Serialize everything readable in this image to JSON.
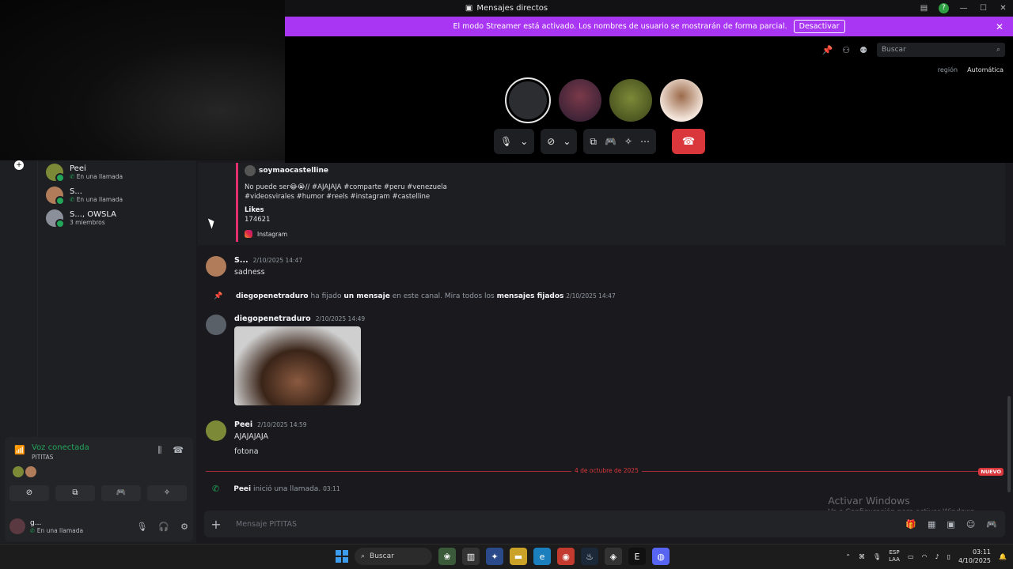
{
  "window": {
    "title": "Mensajes directos"
  },
  "banner": {
    "text": "El modo Streamer está activado. Los nombres de usuario se mostrarán de forma parcial.",
    "button": "Desactivar",
    "close": "✕"
  },
  "call": {
    "search_placeholder": "Buscar",
    "region_label": "región",
    "region_value": "Automática"
  },
  "sidebar": {
    "dms": [
      {
        "name": "Peei",
        "sub": "En una llamada"
      },
      {
        "name": "S...",
        "sub": "En una llamada"
      },
      {
        "name": "S..., OWSLA",
        "sub": "3 miembros"
      }
    ],
    "voice": {
      "status": "Voz conectada",
      "channel": "PITITAS"
    },
    "user": {
      "name": "g...",
      "status": "En una llamada"
    }
  },
  "chat": {
    "embed": {
      "author": "soymaocastelline",
      "text": "No puede ser😂😭// #AJAJAJA #comparte #peru #venezuela #videosvirales #humor #reels #instagram #castelline",
      "likes_label": "Likes",
      "likes_value": "174621",
      "source": "Instagram"
    },
    "messages": [
      {
        "author": "S...",
        "time": "2/10/2025 14:47",
        "text": "sadness"
      },
      {
        "author": "diegopenetraduro",
        "time": "2/10/2025 14:49"
      },
      {
        "author": "Peei",
        "time": "2/10/2025 14:59",
        "text": "AJAJAJAJA",
        "text2": "fotona"
      }
    ],
    "pin_event": {
      "user": "diegopenetraduro",
      "t1": "ha fijado",
      "link1": "un mensaje",
      "t2": "en este canal. Mira todos los",
      "link2": "mensajes fijados",
      "time": "2/10/2025 14:47"
    },
    "divider": {
      "date": "4 de octubre de 2025",
      "badge": "NUEVO"
    },
    "call_event": {
      "user": "Peei",
      "text": "inició una llamada.",
      "time": "03:11"
    },
    "composer_placeholder": "Mensaje PITITAS"
  },
  "watermark": {
    "line1": "Activar Windows",
    "line2": "Ve a Configuración para activar Windows."
  },
  "taskbar": {
    "search": "Buscar",
    "lang1": "ESP",
    "lang2": "LAA",
    "time": "03:11",
    "date": "4/10/2025"
  },
  "colors": {
    "streamer_banner": "#a936f2",
    "hangup": "#da373c",
    "online": "#23a55a"
  }
}
